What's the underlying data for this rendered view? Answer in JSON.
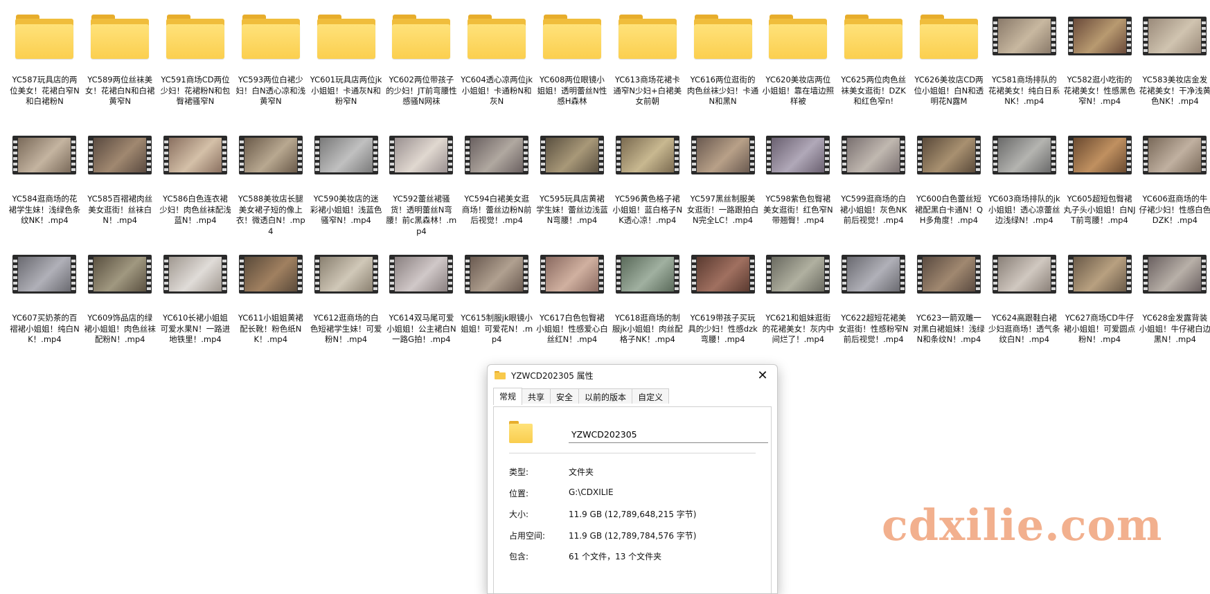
{
  "items": [
    {
      "type": "folder",
      "name": "YC587玩具店的两位美女！花裙白窄N和白裙粉N"
    },
    {
      "type": "folder",
      "name": "YC589两位丝袜美女！花裙白N和白裙黄窄N"
    },
    {
      "type": "folder",
      "name": "YC591商场CD两位少妇！花裙粉N和包臀裙骚窄N"
    },
    {
      "type": "folder",
      "name": "YC593两位白裙少妇！白N透心凉和浅黄窄N"
    },
    {
      "type": "folder",
      "name": "YC601玩具店两位jk小姐姐！卡通灰N和粉窄N"
    },
    {
      "type": "folder",
      "name": "YC602两位带孩子的少妇！JT前弯腰性感骚N网袜"
    },
    {
      "type": "folder",
      "name": "YC604透心凉两位jk小姐姐！卡通粉N和灰N"
    },
    {
      "type": "folder",
      "name": "YC608两位眼镜小姐姐！透明蕾丝N性感H森林"
    },
    {
      "type": "folder",
      "name": "YC613商场花裙卡通窄N少妇+白裙美女前朝"
    },
    {
      "type": "folder",
      "name": "YC616两位逛街的肉色丝袜少妇！卡通N和黑N"
    },
    {
      "type": "folder",
      "name": "YC620美妆店两位小姐姐！靠在墙边照样被"
    },
    {
      "type": "folder",
      "name": "YC625两位肉色丝袜美女逛街！DZK和红色窄n!"
    },
    {
      "type": "folder",
      "name": "YC626美妆店CD两位小姐姐！白N和透明花N露M"
    },
    {
      "type": "video",
      "name": "YC581商场排队的花裙美女！纯白日系NK！.mp4",
      "tone": [
        "#8a7a6a",
        "#c8b8a0"
      ]
    },
    {
      "type": "video",
      "name": "YC582逛小吃街的花裙美女！性感黑色窄N！.mp4",
      "tone": [
        "#6a4a3a",
        "#b89a70"
      ]
    },
    {
      "type": "video",
      "name": "YC583美妆店金发花裙美女！干净浅黄色NK！.mp4",
      "tone": [
        "#9a8a7a",
        "#d0c4b0"
      ]
    },
    {
      "type": "video",
      "name": "YC584逛商场的花裙学生妹！浅绿色条纹NK！.mp4",
      "tone": [
        "#7a6a5a",
        "#c4b4a0"
      ]
    },
    {
      "type": "video",
      "name": "YC585百褶裙肉丝美女逛街！丝袜白N！.mp4",
      "tone": [
        "#5a4a40",
        "#a08870"
      ]
    },
    {
      "type": "video",
      "name": "YC586白色连衣裙少妇！肉色丝袜配浅蓝N！.mp4",
      "tone": [
        "#8a7060",
        "#d4c0a8"
      ]
    },
    {
      "type": "video",
      "name": "YC588美妆店长腿美女裙子短的像上衣！微透白N！.mp4",
      "tone": [
        "#6a5a4a",
        "#b8a890"
      ]
    },
    {
      "type": "video",
      "name": "YC590美妆店的迷彩裙小姐姐！浅蓝色骚窄N！.mp4",
      "tone": [
        "#7a7a7a",
        "#c0c0c0"
      ]
    },
    {
      "type": "video",
      "name": "YC592蕾丝裙骚货！透明蕾丝N弯腰！前c黑森林！.mp4",
      "tone": [
        "#9a9090",
        "#e0d8d0"
      ]
    },
    {
      "type": "video",
      "name": "YC594白裙美女逛商场！蕾丝边粉N前后视觉！.mp4",
      "tone": [
        "#6a6060",
        "#b0a8a0"
      ]
    },
    {
      "type": "video",
      "name": "YC595玩具店黄裙学生妹！蕾丝边浅蓝N弯腰！.mp4",
      "tone": [
        "#5a5040",
        "#a89878"
      ]
    },
    {
      "type": "video",
      "name": "YC596黄色格子裙小姐姐！蓝白格子NK透心凉！.mp4",
      "tone": [
        "#7a6a50",
        "#c8b890"
      ]
    },
    {
      "type": "video",
      "name": "YC597黑丝制服美女逛街！一路跟拍白N完全LC！.mp4",
      "tone": [
        "#6a5a50",
        "#b8a088"
      ]
    },
    {
      "type": "video",
      "name": "YC598紫色包臀裙美女逛街！红色窄N带翘臀！.mp4",
      "tone": [
        "#6a6070",
        "#b0a8b8"
      ]
    },
    {
      "type": "video",
      "name": "YC599逛商场的白裙小姐姐！灰色NK前后视觉！.mp4",
      "tone": [
        "#7a7070",
        "#c0b8b0"
      ]
    },
    {
      "type": "video",
      "name": "YC600白色蕾丝短裙配黑白卡通N！QH多角度！.mp4",
      "tone": [
        "#5a4a3a",
        "#a89070"
      ]
    },
    {
      "type": "video",
      "name": "YC603商场排队的jk小姐姐！透心凉蕾丝边浅绿N！.mp4",
      "tone": [
        "#6a6a6a",
        "#b4b4b0"
      ]
    },
    {
      "type": "video",
      "name": "YC605超短包臀裙丸子头小姐姐！白NJT前弯腰！.mp4",
      "tone": [
        "#6a4a30",
        "#c09060"
      ]
    },
    {
      "type": "video",
      "name": "YC606逛商场的牛仔裙少妇！性感白色DZK！.mp4",
      "tone": [
        "#7a6a5a",
        "#c0b0a0"
      ]
    },
    {
      "type": "video",
      "name": "YC607买奶茶的百褶裙小姐姐！纯白NK！.mp4",
      "tone": [
        "#6a6a70",
        "#b0b0b8"
      ]
    },
    {
      "type": "video",
      "name": "YC609饰品店的绿裙小姐姐！肉色丝袜配粉N！.mp4",
      "tone": [
        "#5a5040",
        "#a09880"
      ]
    },
    {
      "type": "video",
      "name": "YC610长裙小姐姐可爱水果N！一路进地铁里！.mp4",
      "tone": [
        "#a09890",
        "#e0dcd8"
      ]
    },
    {
      "type": "video",
      "name": "YC611小姐姐黄裙配长靴！粉色纸NK！.mp4",
      "tone": [
        "#5a4a3a",
        "#a08060"
      ]
    },
    {
      "type": "video",
      "name": "YC612逛商场的白色短裙学生妹！可爱粉N！.mp4",
      "tone": [
        "#8a8070",
        "#d0c8b8"
      ]
    },
    {
      "type": "video",
      "name": "YC614双马尾可爱小姐姐！公主裙白N一路G拍！.mp4",
      "tone": [
        "#8a8080",
        "#d0c8c8"
      ]
    },
    {
      "type": "video",
      "name": "YC615制服jk眼镜小姐姐！可爱花N！.mp4",
      "tone": [
        "#6a5a50",
        "#b0a090"
      ]
    },
    {
      "type": "video",
      "name": "YC617白色包臀裙小姐姐！性感爱心白丝红N！.mp4",
      "tone": [
        "#8a6a60",
        "#d0b0a0"
      ]
    },
    {
      "type": "video",
      "name": "YC618逛商场的制服jk小姐姐！肉丝配格子NK！.mp4",
      "tone": [
        "#5a6a5a",
        "#a0b0a0"
      ]
    },
    {
      "type": "video",
      "name": "YC619带孩子买玩具的少妇！性感dzk弯腰！.mp4",
      "tone": [
        "#5a3a30",
        "#a07060"
      ]
    },
    {
      "type": "video",
      "name": "YC621和姐妹逛街的花裙美女！灰内中间烂了！.mp4",
      "tone": [
        "#6a6a60",
        "#b0b0a0"
      ]
    },
    {
      "type": "video",
      "name": "YC622超短花裙美女逛街！性感粉窄N前后视觉！.mp4",
      "tone": [
        "#6a6a70",
        "#b0b0b8"
      ]
    },
    {
      "type": "video",
      "name": "YC623一箭双雕一对黑白裙姐妹！浅绿N和条纹N！.mp4",
      "tone": [
        "#5a4a40",
        "#a08870"
      ]
    },
    {
      "type": "video",
      "name": "YC624高跟鞋白裙少妇逛商场！透气条纹白N！.mp4",
      "tone": [
        "#8a8078",
        "#d0c8c0"
      ]
    },
    {
      "type": "video",
      "name": "YC627商场CD牛仔裙小姐姐！可爱圆点粉N！.mp4",
      "tone": [
        "#6a5a48",
        "#b8a080"
      ]
    },
    {
      "type": "video",
      "name": "YC628金发露背装小姐姐！牛仔裙白边黑N！.mp4",
      "tone": [
        "#6a6060",
        "#b8b0a8"
      ]
    }
  ],
  "dialog": {
    "title": "YZWCD202305 属性",
    "tabs": [
      "常规",
      "共享",
      "安全",
      "以前的版本",
      "自定义"
    ],
    "active_tab": 0,
    "name_value": "YZWCD202305",
    "props": [
      {
        "key": "类型:",
        "value": "文件夹"
      },
      {
        "key": "位置:",
        "value": "G:\\CDXILIE"
      },
      {
        "key": "大小:",
        "value": "11.9 GB (12,789,648,215 字节)"
      },
      {
        "key": "占用空间:",
        "value": "11.9 GB (12,789,784,576 字节)"
      },
      {
        "key": "包含:",
        "value": "61 个文件，13 个文件夹"
      }
    ]
  },
  "watermark": "cdxilie.com"
}
